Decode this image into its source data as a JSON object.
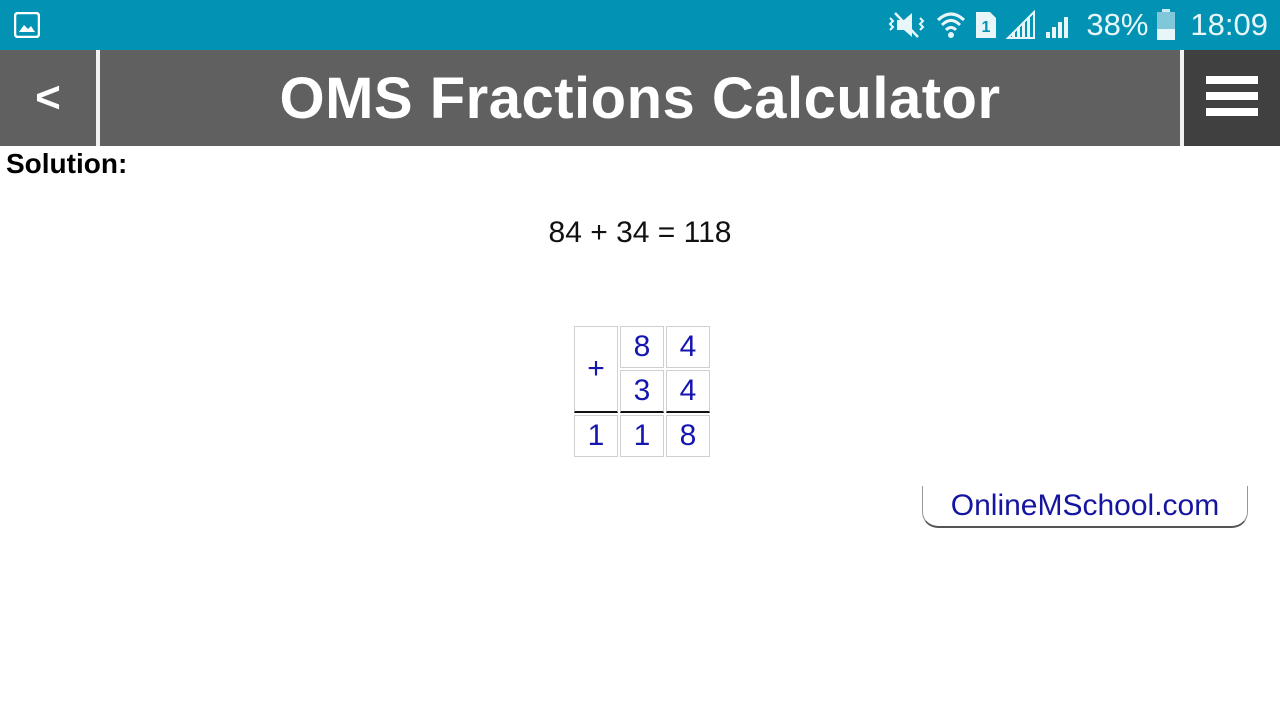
{
  "status_bar": {
    "left_icon": "gallery-icon",
    "icons": [
      "mute-vibrate-icon",
      "wifi-icon",
      "sim-1-icon",
      "signal-icon",
      "signal-icon"
    ],
    "battery_percent": "38%",
    "time": "18:09",
    "background_color": "#0192b4"
  },
  "app_bar": {
    "back_label": "<",
    "title": "OMS Fractions Calculator",
    "menu_icon": "hamburger-menu-icon",
    "background_color": "#606060"
  },
  "content": {
    "solution_label": "Solution:",
    "equation": "84 + 34 = 118",
    "column_addition": {
      "operator": "+",
      "row1": [
        "8",
        "4"
      ],
      "row2": [
        "3",
        "4"
      ],
      "result": [
        "1",
        "1",
        "8"
      ],
      "digit_color": "#1515b0"
    },
    "site_link": "OnlineMSchool.com"
  }
}
